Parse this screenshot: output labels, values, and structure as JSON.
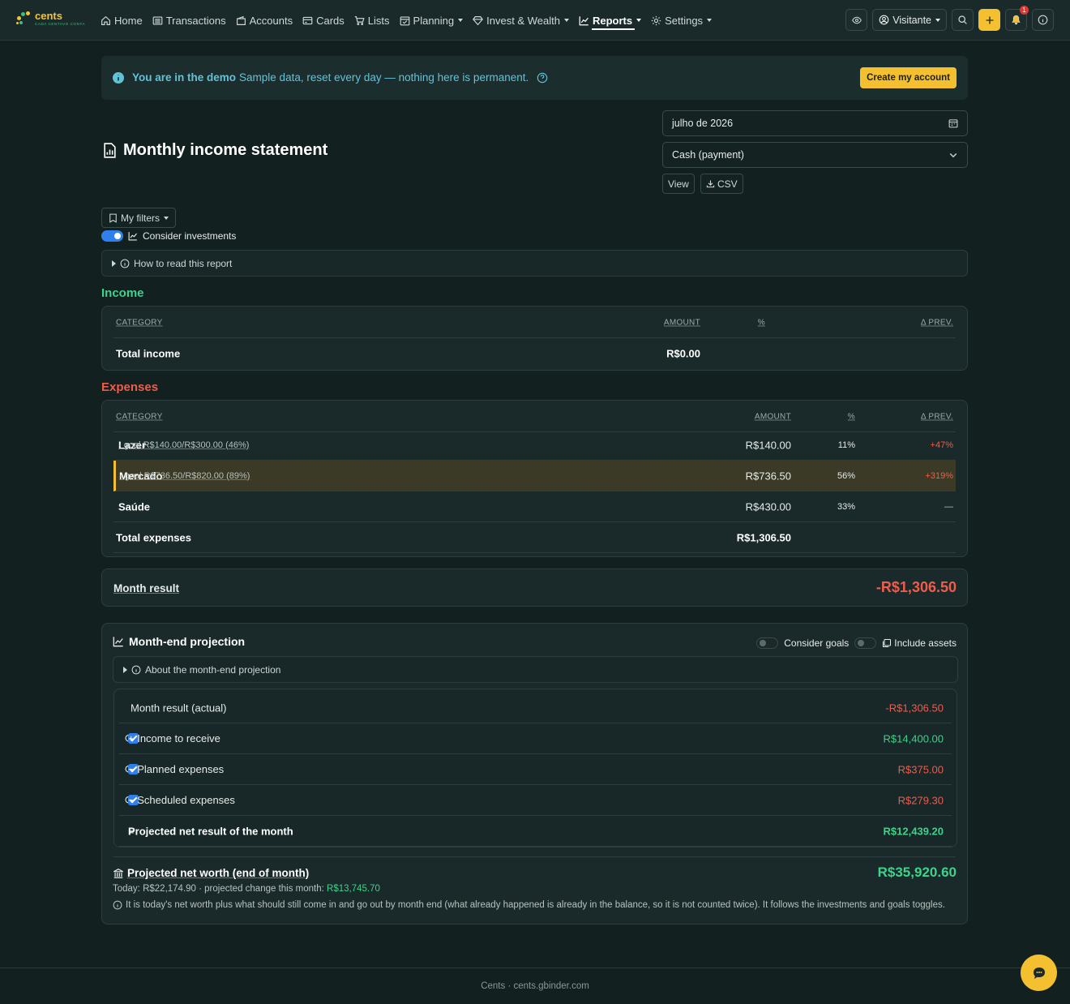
{
  "brand": {
    "name": "cents",
    "tagline": "CADA CENTAVO CONTA"
  },
  "nav": {
    "home": "Home",
    "transactions": "Transactions",
    "accounts": "Accounts",
    "cards": "Cards",
    "lists": "Lists",
    "planning": "Planning",
    "invest": "Invest & Wealth",
    "reports": "Reports",
    "settings": "Settings",
    "user": "Visitante",
    "notifications_count": "1"
  },
  "demo": {
    "title": "You are in the demo",
    "text": "Sample data, reset every day — nothing here is permanent.",
    "cta": "Create my account"
  },
  "page": {
    "title": "Monthly income statement"
  },
  "controls": {
    "month": "julho de 2026",
    "basis": "Cash (payment)",
    "view": "View",
    "csv": "CSV",
    "filters": "My filters",
    "consider_investments": "Consider investments",
    "how_to_read": "How to read this report"
  },
  "income": {
    "title": "Income",
    "headers": {
      "category": "CATEGORY",
      "amount": "AMOUNT",
      "pct": "%",
      "delta": "Δ PREV."
    },
    "total_label": "Total income",
    "total_amount": "R$0.00"
  },
  "expenses": {
    "title": "Expenses",
    "headers": {
      "category": "CATEGORY",
      "amount": "AMOUNT",
      "pct": "%",
      "delta": "Δ PREV."
    },
    "rows": [
      {
        "name": "Lazer",
        "goal": "· goal R$140.00/R$300.00 (46%)",
        "amount": "R$140.00",
        "pct": "11%",
        "delta": "+47%"
      },
      {
        "name": "Mercado",
        "goal": "· goal R$736.50/R$820.00 (89%)",
        "amount": "R$736.50",
        "pct": "56%",
        "delta": "+319%"
      },
      {
        "name": "Saúde",
        "goal": "",
        "amount": "R$430.00",
        "pct": "33%",
        "delta": "—"
      }
    ],
    "total_label": "Total expenses",
    "total_amount": "R$1,306.50"
  },
  "month_result": {
    "label": "Month result",
    "value": "-R$1,306.50"
  },
  "projection": {
    "title": "Month-end projection",
    "consider_goals": "Consider goals",
    "include_assets": "Include assets",
    "about": "About the month-end projection",
    "actual_label": "Month result (actual)",
    "actual_value": "-R$1,306.50",
    "income_label": "+ Income to receive",
    "income_value": "R$14,400.00",
    "planned_label": "− Planned expenses",
    "planned_value": "R$375.00",
    "scheduled_label": "− Scheduled expenses",
    "scheduled_value": "R$279.30",
    "net_prefix": "=",
    "net_label": "Projected net result of the month",
    "net_value": "R$12,439.20",
    "networth_label": "Projected net worth (end of month)",
    "networth_value": "R$35,920.60",
    "today_text": "Today: R$22,174.90  · projected change this month:",
    "change_value": "R$13,745.70",
    "note": "It is today's net worth plus what should still come in and go out by month end (what already happened is already in the balance, so it is not counted twice). It follows the investments and goals toggles."
  },
  "footer": {
    "text": "Cents · cents.gbinder.com"
  }
}
